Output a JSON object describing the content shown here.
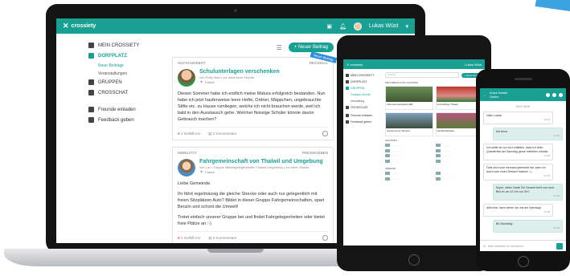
{
  "brand": {
    "name": "crossiety",
    "accent": "#1a9f93"
  },
  "laptop": {
    "topbar": {
      "user": "Lukas Wüst"
    },
    "new_post": "+ Neuer Beitrag",
    "sidebar": [
      {
        "label": "MEIN CROSSIETY",
        "icon": "crossiety-icon",
        "active": false
      },
      {
        "label": "DORFPLATZ",
        "icon": "square-icon",
        "active": true
      },
      {
        "label": "Neue Beiträge",
        "sub": true
      },
      {
        "label": "Veranstaltungen",
        "sub": true
      },
      {
        "label": "GRUPPEN",
        "icon": "groups-icon",
        "active": false
      },
      {
        "label": "CROSSCHAT",
        "icon": "chat-icon",
        "active": false
      },
      {
        "label": "Freunde einladen",
        "icon": "invite-icon",
        "active": false
      },
      {
        "label": "Feedback geben",
        "icon": "feedback-icon",
        "active": false
      }
    ],
    "posts": [
      {
        "category": "Hilfsangebot",
        "scope": "Regional",
        "ribbon": "Neuer Beitrag",
        "title": "Schulunterlagen verschenken",
        "meta": "von Philip Bott • vor etwa einer Stunde",
        "location": "Thalwil",
        "body": [
          "Diesen Sommer habe ich endlich meine Matura erfolgreich bestanden. Nun habe ich jetzt haufenweise leere Hefte, Ordner, Mäppchen, ungebrauchte Stifte etc. zu Hause rumliegen, welche ich nicht brauchen werde, weil ich bald in den Ausstausch gehe. Welcher fleissige Schüler könnte davon Gebrauch machen?"
        ],
        "likes": "2 Gefällt mir",
        "comments": "2 Kommentare"
      },
      {
        "category": "Mobilität",
        "scope": "Freigegeben",
        "title": "Fahrgemeinschaft von Thalwil und Umgebung",
        "meta": "von Luc • Gruppe Mitfahrgelegenheiten Thalwil Umgebung • vor einer Stunde",
        "location": "Thalwil",
        "body": [
          "Liebe Gemeinde",
          "Ihr fährt regelmässig die gleiche Strecke oder auch nur gelegentlich mit freien Sitzplätzen Auto? Bildet in dieser Gruppe Fahrgemeinschaften, spart Benzin und schont die Umwelt!",
          "Tretet einfach unserer Gruppe bei und findet Fahrgelegenheiten oder bietet freie Plätze an :-)"
        ],
        "likes": "2 Gefällt mir",
        "comments": "6 Kommentare"
      }
    ]
  },
  "tablet": {
    "user": "Lukas Wüst",
    "sidebar": [
      "MEIN CROSSIETY",
      "DORFPLATZ",
      "GRUPPEN",
      "CROSSCHAT",
      "Freunde einladen",
      "Feedback geben"
    ],
    "sidebar_sub": [
      "Gruppen-Suche",
      "Verwaltung"
    ],
    "search_placeholder": "Suchen",
    "new_group": "+ Neue Gruppe",
    "section_top": "Meistbesuchte Gruppen",
    "tiles": [
      "Abenteuerspielplatz ABF",
      "Freizeitlinge Thalwil",
      "Gartenverein Allmend",
      "Hackbrettlihalde"
    ],
    "section_mid": "Gruppen",
    "section_bottom": "Vereine"
  },
  "phone": {
    "contact": "Anna Muster",
    "status": "Online",
    "day": "09.07.2019",
    "messages": [
      {
        "me": false,
        "text": "Hallo Lukas!",
        "time": "17:11"
      },
      {
        "me": true,
        "text": "Hoi Anna",
        "time": "17:12"
      },
      {
        "me": false,
        "text": "Ich wollte dir nur kurz mitteilen, dass ich beim Quartierfest am Samstag gerne mithelfen möchte.",
        "time": "17:13"
      },
      {
        "me": false,
        "text": "Falls sich noch niemand gemeldet hat, kann ich auch noch einen Dessert machen :-)",
        "time": "17:14"
      },
      {
        "me": true,
        "text": "Super, vielen Dank! Ein Dessert fehlt uns noch. Bist du um 10 Uhr vor Ort?",
        "time": "17:15"
      },
      {
        "me": false,
        "text": "Alles klar, dann sehen wir uns am Samstag!",
        "time": "17:16"
      },
      {
        "me": true,
        "text": "Bis Samstag!",
        "time": "17:16"
      }
    ],
    "input_placeholder": "Was möchtest du schreiben?"
  }
}
